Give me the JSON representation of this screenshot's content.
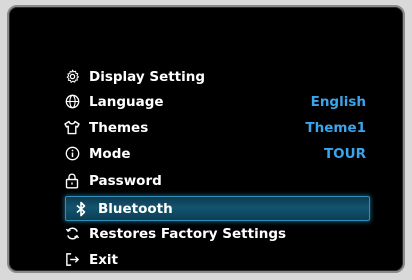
{
  "menu": {
    "items": [
      {
        "label": "Display Setting",
        "value": "",
        "icon": "gear-icon"
      },
      {
        "label": "Language",
        "value": "English",
        "icon": "globe-icon"
      },
      {
        "label": "Themes",
        "value": "Theme1",
        "icon": "shirt-icon"
      },
      {
        "label": "Mode",
        "value": "TOUR",
        "icon": "info-icon"
      },
      {
        "label": "Password",
        "value": "",
        "icon": "lock-icon"
      },
      {
        "label": "Bluetooth",
        "value": "",
        "icon": "bluetooth-icon"
      },
      {
        "label": "Restores Factory Settings",
        "value": "",
        "icon": "refresh-icon"
      },
      {
        "label": "Exit",
        "value": "",
        "icon": "exit-icon"
      }
    ],
    "selected_index": 5
  },
  "colors": {
    "background": "#000000",
    "text": "#ffffff",
    "value": "#3aa5ea",
    "highlight": "#12546f"
  }
}
